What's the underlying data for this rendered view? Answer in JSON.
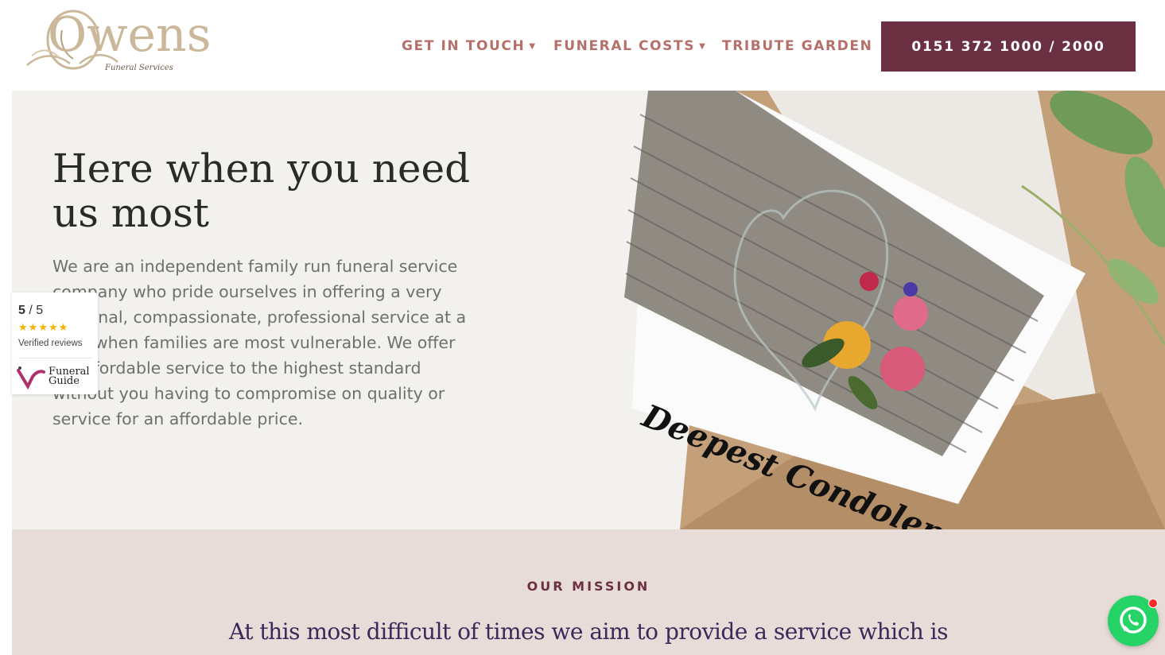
{
  "header": {
    "logo_word": "Owens",
    "logo_sub": "Funeral Services",
    "nav": [
      {
        "label": "GET IN TOUCH",
        "has_dropdown": true
      },
      {
        "label": "FUNERAL COSTS",
        "has_dropdown": true
      },
      {
        "label": "TRIBUTE GARDEN",
        "has_dropdown": false
      }
    ],
    "phone": "0151 372 1000 / 2000"
  },
  "hero": {
    "title": "Here when you need us most",
    "text": "We are an independent family run funeral service company who pride ourselves in offering a very personal, compassionate, professional service at a time when families are most vulnerable. We offer an affordable service to the highest standard without you having to compromise on quality or service for an affordable price.",
    "image_caption": "Deepest Condolences"
  },
  "badge": {
    "score": "5",
    "out_of": "/ 5",
    "stars": "★★★★★",
    "rating": 5,
    "verified": "Verified reviews",
    "brand_line1": "Funeral",
    "brand_line2": "Guide"
  },
  "mission": {
    "label": "OUR MISSION",
    "text": "At this most difficult of times we aim to provide a service which is"
  },
  "colors": {
    "accent": "#6b3142",
    "nav": "#b5706a",
    "logo": "#cbb89a",
    "hero_bg": "#f2f1ee",
    "mission_bg": "#e8dcd8",
    "whatsapp": "#25d366"
  }
}
